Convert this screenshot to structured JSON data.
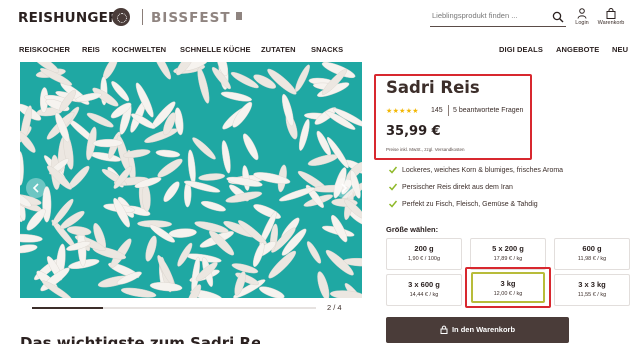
{
  "header": {
    "logo_primary": "REISHUNGER",
    "logo_secondary": "BISSFEST",
    "search_placeholder": "Lieblingsprodukt finden ...",
    "login_label": "Login",
    "cart_label": "Warenkorb"
  },
  "nav": {
    "left": [
      "REISKOCHER",
      "REIS",
      "KOCHWELTEN",
      "SCHNELLE KÜCHE",
      "ZUTATEN",
      "SNACKS"
    ],
    "right": [
      "DIGI DEALS",
      "ANGEBOTE",
      "NEU"
    ]
  },
  "gallery": {
    "page_indicator": "2 / 4",
    "progress": 0.25,
    "below_heading": "Das wichtigste zum Sadri Reis"
  },
  "product": {
    "title": "Sadri Reis",
    "rating_stars": 5,
    "stars_glyph": "★★★★★",
    "review_count": "145",
    "questions": "5 beantwortete Fragen",
    "price": "35,99 €",
    "price_note": "Preise inkl. MwSt., zzgl. Versandkosten",
    "features": [
      "Lockeres, weiches Korn & blumiges, frisches Aroma",
      "Persischer Reis direkt aus dem Iran",
      "Perfekt zu Fisch, Fleisch, Gemüse & Tahdig"
    ],
    "size_heading": "Größe wählen:",
    "sizes": [
      {
        "label": "200 g",
        "unit_price": "1,90 € / 100g"
      },
      {
        "label": "5 x 200 g",
        "unit_price": "17,89 € / kg"
      },
      {
        "label": "600 g",
        "unit_price": "11,98 € / kg"
      },
      {
        "label": "3 x 600 g",
        "unit_price": "14,44 € / kg"
      },
      {
        "label": "3 kg",
        "unit_price": "12,00 € / kg"
      },
      {
        "label": "3 x 3 kg",
        "unit_price": "11,55 € / kg"
      }
    ],
    "selected_size": "3 kg",
    "cart_button": "In den Warenkorb"
  },
  "colors": {
    "brand_dark": "#4a3c39",
    "accent_teal": "#1fa8a3",
    "star": "#f2b705",
    "check": "#8fb92a",
    "highlight": "#d8282f",
    "selected_border": "#b8bc3a"
  },
  "icons": [
    "search-icon",
    "user-icon",
    "shopping-bag-icon",
    "chevron-left-icon",
    "chevron-right-icon",
    "check-icon",
    "lock-icon"
  ]
}
